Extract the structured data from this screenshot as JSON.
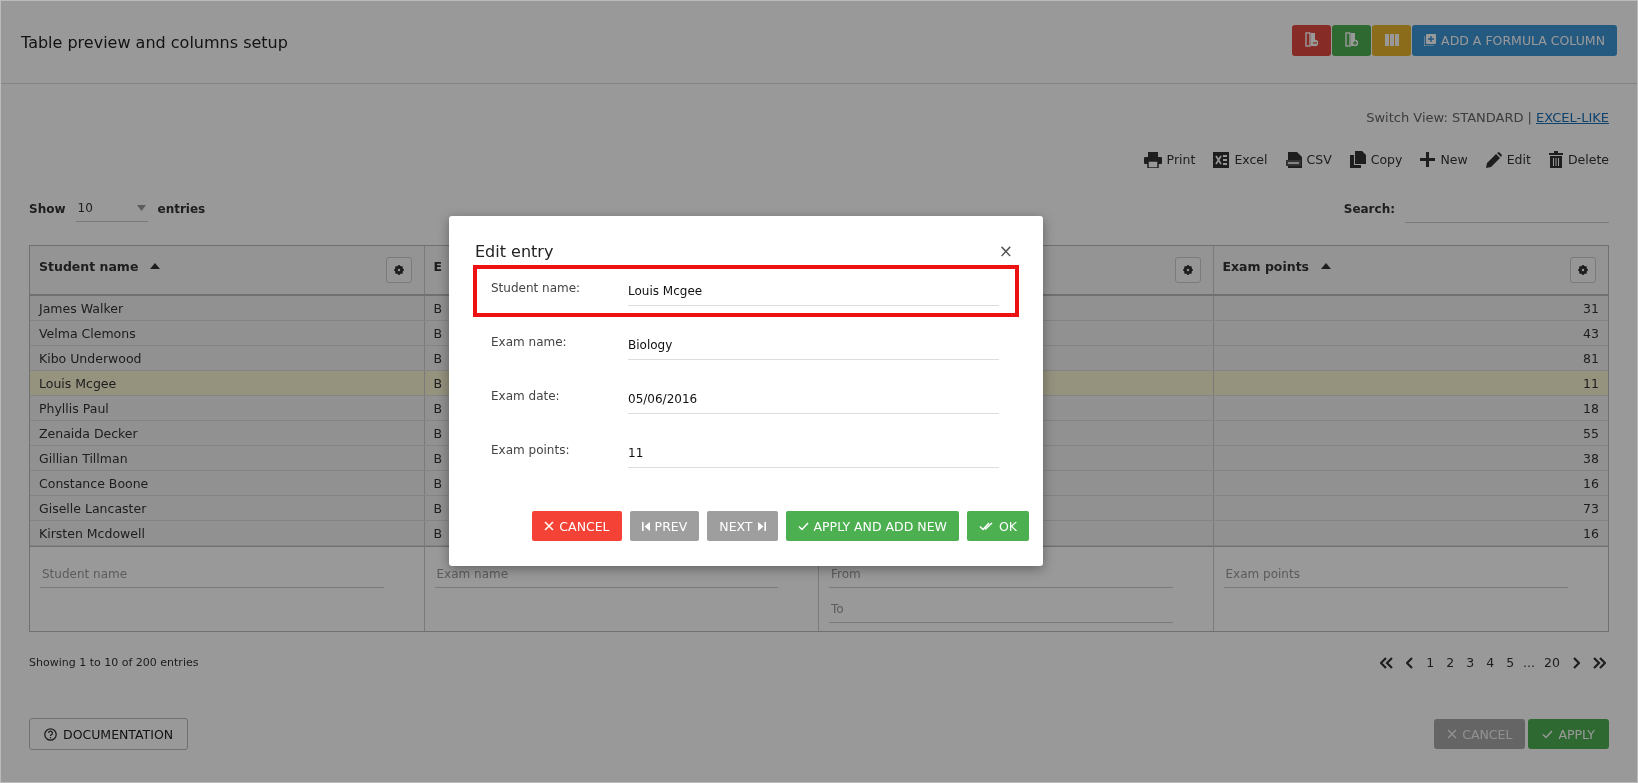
{
  "header": {
    "title": "Table preview and columns setup",
    "column_buttons": [
      {
        "kind": "remove"
      },
      {
        "kind": "add"
      },
      {
        "kind": "columns"
      }
    ],
    "formula_button": "ADD A FORMULA COLUMN"
  },
  "switch_view": {
    "label": "Switch View: STANDARD |",
    "link": "EXCEL-LIKE"
  },
  "toolbar": [
    {
      "kind": "print",
      "label": "Print"
    },
    {
      "kind": "excel",
      "label": "Excel"
    },
    {
      "kind": "csv",
      "label": "CSV"
    },
    {
      "kind": "copy",
      "label": "Copy"
    },
    {
      "kind": "new",
      "label": "New"
    },
    {
      "kind": "edit",
      "label": "Edit"
    },
    {
      "kind": "delete",
      "label": "Delete"
    }
  ],
  "length": {
    "label": "Show",
    "value": "10",
    "suffix": "entries"
  },
  "search": {
    "label": "Search:"
  },
  "table": {
    "columns": [
      {
        "label": "Student name",
        "sorted": true,
        "gear": true
      },
      {
        "label": "E",
        "gear": false
      },
      {
        "gear": true
      },
      {
        "label": "Exam points",
        "sorted": true,
        "gear": true
      }
    ],
    "rows": [
      {
        "student": "James Walker",
        "column_2": "B",
        "points": "31",
        "selected": false
      },
      {
        "student": "Velma Clemons",
        "column_2": "B",
        "points": "43",
        "selected": false
      },
      {
        "student": "Kibo Underwood",
        "column_2": "B",
        "points": "81",
        "selected": false
      },
      {
        "student": "Louis Mcgee",
        "column_2": "B",
        "points": "11",
        "selected": true
      },
      {
        "student": "Phyllis Paul",
        "column_2": "B",
        "points": "18",
        "selected": false
      },
      {
        "student": "Zenaida Decker",
        "column_2": "B",
        "points": "55",
        "selected": false
      },
      {
        "student": "Gillian Tillman",
        "column_2": "B",
        "points": "38",
        "selected": false
      },
      {
        "student": "Constance Boone",
        "column_2": "B",
        "points": "16",
        "selected": false
      },
      {
        "student": "Giselle Lancaster",
        "column_2": "B",
        "points": "73",
        "selected": false
      },
      {
        "student": "Kirsten Mcdowell",
        "column_2": "B",
        "points": "16",
        "selected": false
      }
    ],
    "filters": [
      {
        "kind": "text",
        "placeholders": [
          "Student name"
        ]
      },
      {
        "kind": "text",
        "placeholders": [
          "Exam name"
        ]
      },
      {
        "kind": "range",
        "placeholders": [
          "From",
          "To"
        ]
      },
      {
        "kind": "text",
        "placeholders": [
          "Exam points"
        ]
      }
    ]
  },
  "info": "Showing 1 to 10 of 200 entries",
  "pagination": {
    "pages": [
      "1",
      "2",
      "3",
      "4",
      "5"
    ],
    "ellipsis": "…",
    "last": "20"
  },
  "footer": {
    "documentation": "DOCUMENTATION",
    "cancel": {
      "label": "CANCEL",
      "disabled": true
    },
    "apply": "APPLY"
  },
  "modal": {
    "title": "Edit entry",
    "close": "×",
    "fields": [
      {
        "label": "Student name:",
        "value": "Louis Mcgee",
        "highlighted": true
      },
      {
        "label": "Exam name:",
        "value": "Biology",
        "highlighted": false
      },
      {
        "label": "Exam date:",
        "value": "05/06/2016",
        "highlighted": false
      },
      {
        "label": "Exam points:",
        "value": "11",
        "highlighted": false
      }
    ],
    "buttons": [
      {
        "kind": "cancel",
        "label": "CANCEL"
      },
      {
        "kind": "prev",
        "label": "PREV"
      },
      {
        "kind": "next",
        "label": "NEXT"
      },
      {
        "kind": "apply-new",
        "label": "APPLY AND ADD NEW"
      },
      {
        "kind": "ok",
        "label": "OK"
      }
    ]
  }
}
